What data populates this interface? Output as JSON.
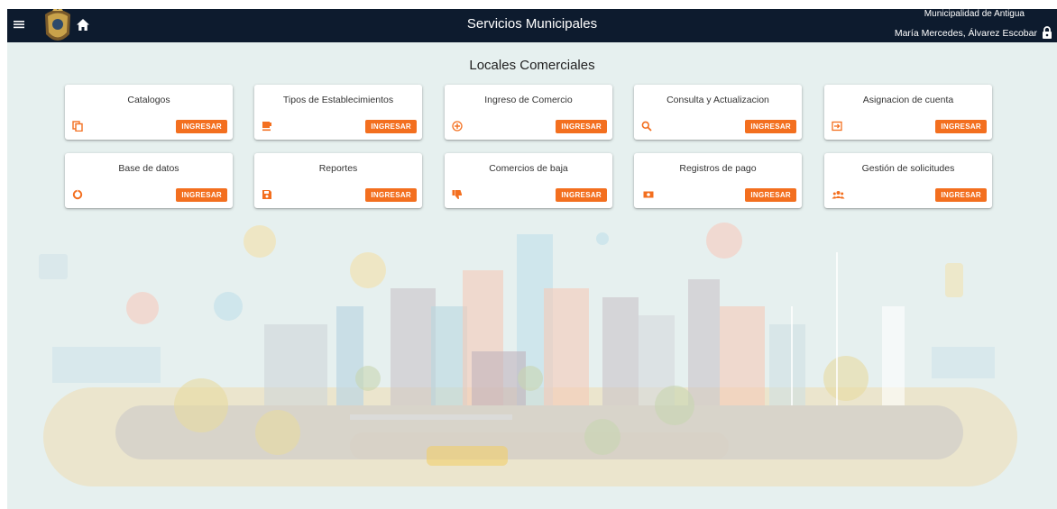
{
  "header": {
    "title": "Servicios Municipales",
    "municipality": "Municipalidad de Antigua",
    "user_name": "María Mercedes, Álvarez Escobar",
    "bg_color": "#0d1b2e"
  },
  "section": {
    "title": "Locales Comerciales"
  },
  "accent_color": "#f36f1f",
  "cards": [
    {
      "title": "Catalogos",
      "button": "INGRESAR",
      "icon": "copy-icon"
    },
    {
      "title": "Tipos de Establecimientos",
      "button": "INGRESAR",
      "icon": "coffee-icon"
    },
    {
      "title": "Ingreso de Comercio",
      "button": "INGRESAR",
      "icon": "add-circle-icon"
    },
    {
      "title": "Consulta y Actualizacion",
      "button": "INGRESAR",
      "icon": "search-icon"
    },
    {
      "title": "Asignacion de cuenta",
      "button": "INGRESAR",
      "icon": "input-icon"
    },
    {
      "title": "Base de datos",
      "button": "INGRESAR",
      "icon": "donut-icon"
    },
    {
      "title": "Reportes",
      "button": "INGRESAR",
      "icon": "save-icon"
    },
    {
      "title": "Comercios de baja",
      "button": "INGRESAR",
      "icon": "thumb-down-icon"
    },
    {
      "title": "Registros de pago",
      "button": "INGRESAR",
      "icon": "money-icon"
    },
    {
      "title": "Gestión de solicitudes",
      "button": "INGRESAR",
      "icon": "group-icon"
    }
  ]
}
